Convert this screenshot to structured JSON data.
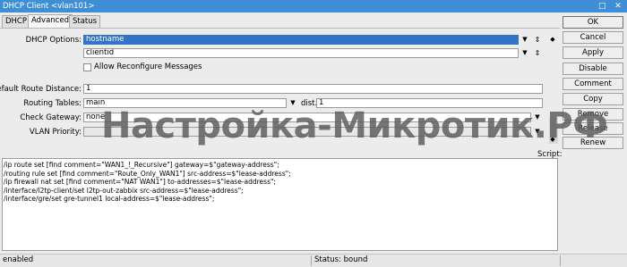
{
  "window": {
    "title": "DHCP Client <vlan101>",
    "controls": [
      "□",
      "✕"
    ]
  },
  "tabs": [
    {
      "label": "DHCP"
    },
    {
      "label": "Advanced",
      "active": true
    },
    {
      "label": "Status"
    }
  ],
  "form": {
    "dhcp_options": {
      "label": "DHCP Options:",
      "values": [
        "hostname",
        "clientid"
      ]
    },
    "allow_reconfigure": {
      "label": "Allow Reconfigure Messages",
      "checked": false
    },
    "default_route_distance": {
      "label": "Default Route Distance:",
      "value": "1"
    },
    "routing_tables": {
      "label": "Routing Tables:",
      "value": "main",
      "dist_label": "dist.",
      "dist_value": "1"
    },
    "check_gateway": {
      "label": "Check Gateway:",
      "value": "none"
    },
    "vlan_priority": {
      "label": "VLAN Priority:",
      "value": ""
    }
  },
  "script": {
    "label": "Script:",
    "lines": [
      "/ip route set [find comment=\"WAN1_!_Recursive\"] gateway=$\"gateway-address\";",
      "/routing rule set [find comment=\"Route_Only_WAN1\"] src-address=$\"lease-address\";",
      "/ip firewall nat set [find comment=\"NAT WAN1\"] to-addresses=$\"lease-address\";",
      "/interface/l2tp-client/set l2tp-out-zabbix src-address=$\"lease-address\";",
      "/interface/gre/set gre-tunnel1 local-address=$\"lease-address\";"
    ]
  },
  "buttons": [
    "OK",
    "Cancel",
    "Apply",
    "Disable",
    "Comment",
    "Copy",
    "Remove",
    "Release",
    "Renew"
  ],
  "status": {
    "left": "enabled",
    "right": "Status: bound"
  },
  "watermark": "Настройка-Микротик.РФ",
  "colors": {
    "titlebar": "#3f8ed6",
    "selection": "#3374c9",
    "window_bg": "#ececec"
  }
}
